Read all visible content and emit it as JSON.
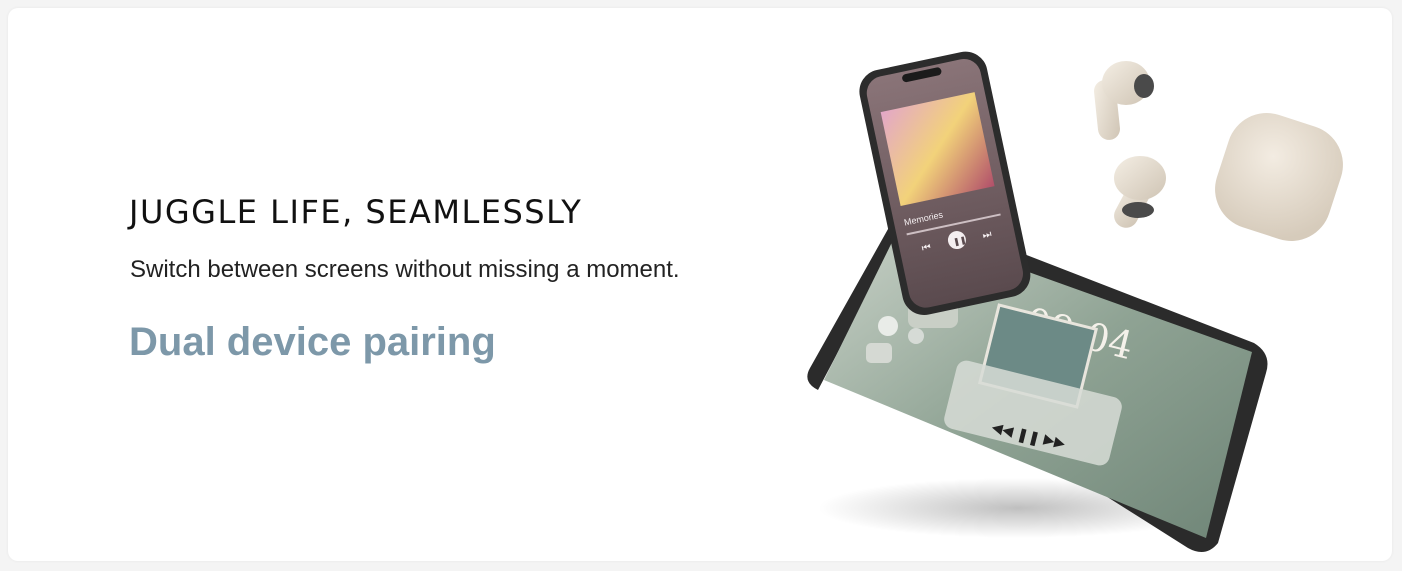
{
  "hero": {
    "headline": "JUGGLE LIFE, SEAMLESSLY",
    "subline": "Switch between screens without missing a moment.",
    "feature": "Dual device pairing"
  },
  "tablet": {
    "clock": "09:04"
  },
  "phone": {
    "track_title": "Memories"
  },
  "colors": {
    "feature_text": "#7d98a9",
    "headline_text": "#111111",
    "earbud": "#e8e0d4"
  },
  "icons": [
    "play-pause-icon",
    "previous-icon",
    "next-icon",
    "rewind-icon",
    "fast-forward-icon",
    "shuffle-icon",
    "repeat-icon"
  ]
}
